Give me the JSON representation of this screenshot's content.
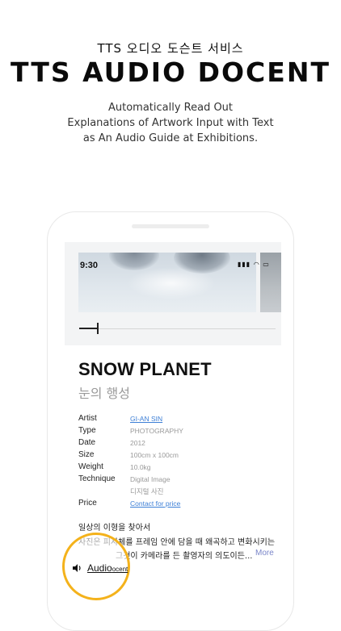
{
  "hero": {
    "subtitle": "TTS 오디오 도슨트 서비스",
    "title": "TTS AUDIO DOCENT",
    "desc_lines": [
      "Automatically Read Out",
      "Explanations of Artwork Input with Text",
      "as An Audio Guide at Exhibitions."
    ]
  },
  "status": {
    "time": "9:30",
    "icons": "▮▮▮ ◠ ▭"
  },
  "player": {
    "progress": 0.09
  },
  "artwork": {
    "title": "SNOW PLANET",
    "title_kr": "눈의 행성",
    "details": [
      {
        "label": "Artist",
        "value": "GI-AN SIN"
      },
      {
        "label": "Type",
        "value": "PHOTOGRAPHY"
      },
      {
        "label": "Date",
        "value": "2012"
      },
      {
        "label": "Size",
        "value": "100cm x 100cm"
      },
      {
        "label": "Weight",
        "value": "10.0kg"
      },
      {
        "label": "Technique",
        "value": "Digital Image",
        "value2": "디지털 사진"
      },
      {
        "label": "Price",
        "value": "Contact for price"
      }
    ],
    "description": [
      "일상의 이형을 찾아서",
      "사진은 피사체를 프레임 안에 담을 때 왜곡하고 변화시키는",
      "그것이 카메라를 든 촬영자의 의도이든..."
    ],
    "more_label": "More"
  },
  "audio": {
    "label": "Audio",
    "label_small": "ocent",
    "icon": "speaker-icon"
  },
  "colors": {
    "accent_circle": "#f4b21b",
    "link": "#3d7fd6"
  }
}
